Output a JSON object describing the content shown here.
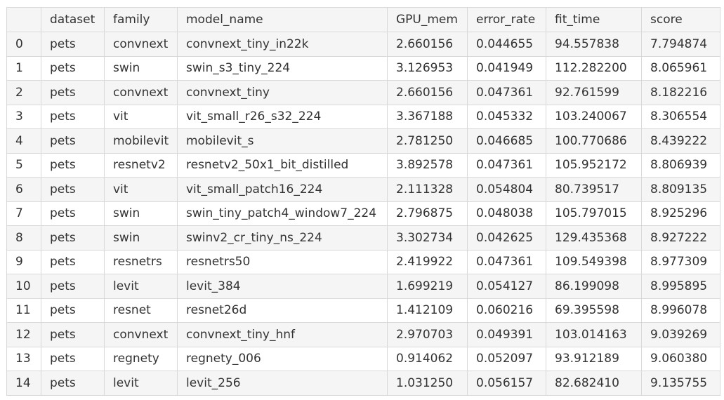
{
  "table": {
    "columns": [
      "",
      "dataset",
      "family",
      "model_name",
      "GPU_mem",
      "error_rate",
      "fit_time",
      "score"
    ],
    "rows": [
      [
        "0",
        "pets",
        "convnext",
        "convnext_tiny_in22k",
        "2.660156",
        "0.044655",
        "94.557838",
        "7.794874"
      ],
      [
        "1",
        "pets",
        "swin",
        "swin_s3_tiny_224",
        "3.126953",
        "0.041949",
        "112.282200",
        "8.065961"
      ],
      [
        "2",
        "pets",
        "convnext",
        "convnext_tiny",
        "2.660156",
        "0.047361",
        "92.761599",
        "8.182216"
      ],
      [
        "3",
        "pets",
        "vit",
        "vit_small_r26_s32_224",
        "3.367188",
        "0.045332",
        "103.240067",
        "8.306554"
      ],
      [
        "4",
        "pets",
        "mobilevit",
        "mobilevit_s",
        "2.781250",
        "0.046685",
        "100.770686",
        "8.439222"
      ],
      [
        "5",
        "pets",
        "resnetv2",
        "resnetv2_50x1_bit_distilled",
        "3.892578",
        "0.047361",
        "105.952172",
        "8.806939"
      ],
      [
        "6",
        "pets",
        "vit",
        "vit_small_patch16_224",
        "2.111328",
        "0.054804",
        "80.739517",
        "8.809135"
      ],
      [
        "7",
        "pets",
        "swin",
        "swin_tiny_patch4_window7_224",
        "2.796875",
        "0.048038",
        "105.797015",
        "8.925296"
      ],
      [
        "8",
        "pets",
        "swin",
        "swinv2_cr_tiny_ns_224",
        "3.302734",
        "0.042625",
        "129.435368",
        "8.927222"
      ],
      [
        "9",
        "pets",
        "resnetrs",
        "resnetrs50",
        "2.419922",
        "0.047361",
        "109.549398",
        "8.977309"
      ],
      [
        "10",
        "pets",
        "levit",
        "levit_384",
        "1.699219",
        "0.054127",
        "86.199098",
        "8.995895"
      ],
      [
        "11",
        "pets",
        "resnet",
        "resnet26d",
        "1.412109",
        "0.060216",
        "69.395598",
        "8.996078"
      ],
      [
        "12",
        "pets",
        "convnext",
        "convnext_tiny_hnf",
        "2.970703",
        "0.049391",
        "103.014163",
        "9.039269"
      ],
      [
        "13",
        "pets",
        "regnety",
        "regnety_006",
        "0.914062",
        "0.052097",
        "93.912189",
        "9.060380"
      ],
      [
        "14",
        "pets",
        "levit",
        "levit_256",
        "1.031250",
        "0.056157",
        "82.682410",
        "9.135755"
      ]
    ]
  }
}
